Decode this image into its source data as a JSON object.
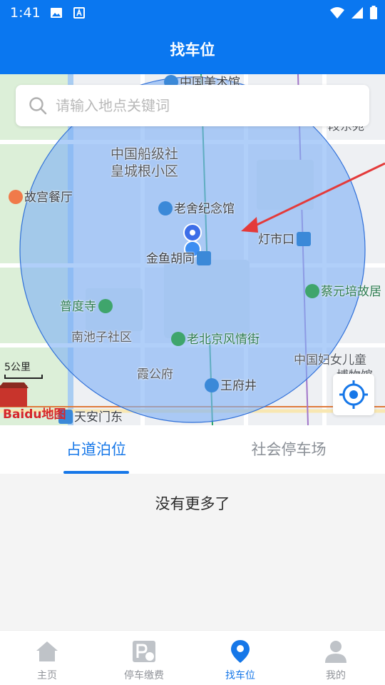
{
  "status": {
    "time": "1:41"
  },
  "header": {
    "title": "找车位"
  },
  "search": {
    "placeholder": "请输入地点关键词"
  },
  "map": {
    "labels": {
      "museum": "中国美术馆",
      "shipbuilding": "中国船级社",
      "huangcheng": "皇城根小区",
      "gugong_restaurant": "故宫餐厅",
      "laoshe": "老舍纪念馆",
      "dengshikou": "灯市口",
      "jinyuhutong": "金鱼胡同",
      "cai_yuanpei": "蔡元培故居",
      "pudusi": "普度寺",
      "nanchizi": "南池子社区",
      "old_beijing": "老北京风情街",
      "women_children": "中国妇女儿童",
      "museum2": "博物馆",
      "xiagongfu": "霞公府",
      "wangfujing": "王府井",
      "tiananmen_east": "天安门东",
      "dongsi": "段东苑",
      "baidu": "Baidu地图"
    },
    "scale": "5公里",
    "circle_color": "#7fb2f5",
    "arrow_color": "#e43a3a"
  },
  "tabs": [
    {
      "label": "占道泊位",
      "active": true
    },
    {
      "label": "社会停车场",
      "active": false
    }
  ],
  "list": {
    "empty_text": "没有更多了"
  },
  "nav": [
    {
      "label": "主页",
      "icon": "home-icon"
    },
    {
      "label": "停车缴费",
      "icon": "parking-fee-icon"
    },
    {
      "label": "找车位",
      "icon": "location-pin-icon",
      "active": true
    },
    {
      "label": "我的",
      "icon": "user-icon"
    }
  ],
  "colors": {
    "primary": "#0a77f0",
    "accent": "#1677e8",
    "inactive": "#909399"
  }
}
